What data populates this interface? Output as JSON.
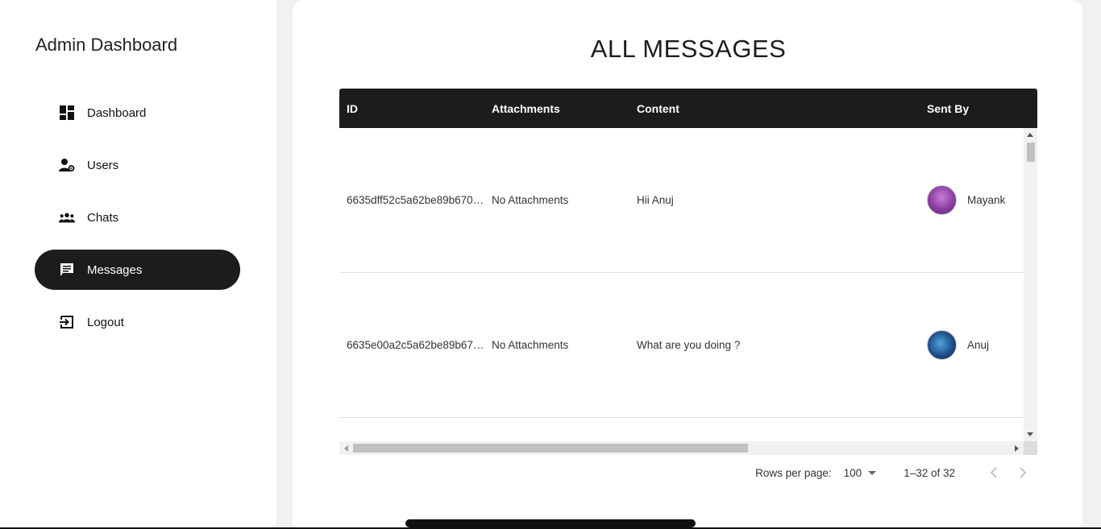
{
  "app": {
    "title": "Admin Dashboard"
  },
  "sidebar": {
    "items": [
      {
        "label": "Dashboard",
        "icon": "dashboard-icon",
        "active": false
      },
      {
        "label": "Users",
        "icon": "manage-users-icon",
        "active": false
      },
      {
        "label": "Chats",
        "icon": "groups-icon",
        "active": false
      },
      {
        "label": "Messages",
        "icon": "message-icon",
        "active": true
      },
      {
        "label": "Logout",
        "icon": "logout-icon",
        "active": false
      }
    ]
  },
  "main": {
    "title": "ALL MESSAGES",
    "table": {
      "columns": [
        "ID",
        "Attachments",
        "Content",
        "Sent By"
      ],
      "rows": [
        {
          "id": "6635dff52c5a62be89b670…",
          "attachments": "No Attachments",
          "content": "Hii Anuj",
          "sender": "Mayank"
        },
        {
          "id": "6635e00a2c5a62be89b67…",
          "attachments": "No Attachments",
          "content": "What are you doing ?",
          "sender": "Anuj"
        }
      ]
    },
    "pagination": {
      "rows_per_page_label": "Rows per page:",
      "rows_per_page": "100",
      "range": "1–32 of 32"
    }
  },
  "colors": {
    "accent": "#1c1c1c",
    "background": "#f1f1f1"
  }
}
